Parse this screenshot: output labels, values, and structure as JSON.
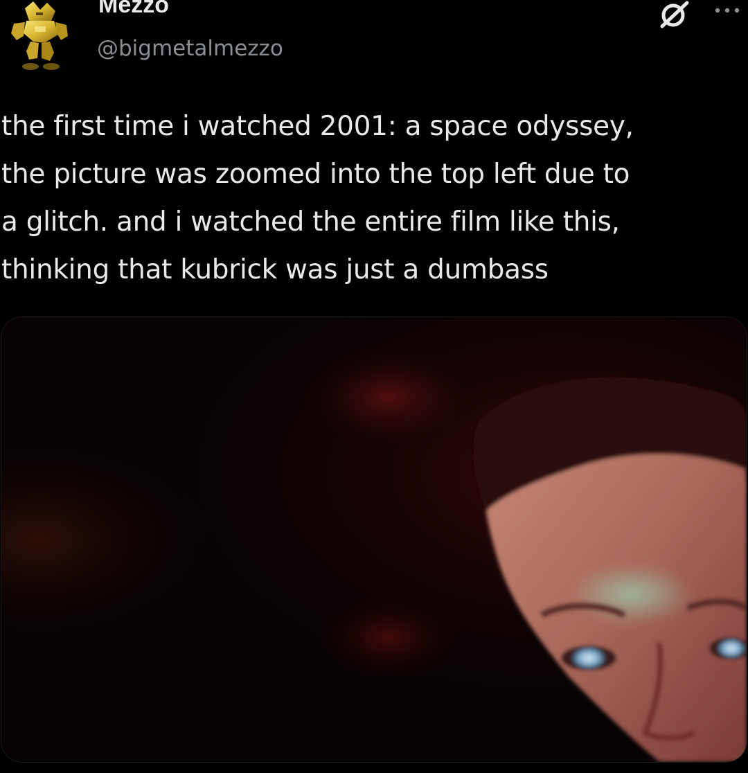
{
  "post": {
    "author": {
      "display_name": "Mezzo",
      "handle": "@bigmetalmezzo"
    },
    "text_lines": [
      "the first time i watched 2001: a space odyssey,",
      "the picture was zoomed into the top left due to",
      "a glitch. and i watched the entire film like this,",
      "thinking that kubrick was just a dumbass"
    ],
    "icons": {
      "avatar": "yellow-robot-avatar",
      "grok": "grok-icon",
      "more": "more-options-icon"
    }
  },
  "colors": {
    "background": "#000000",
    "primary_text": "#e7e9ea",
    "secondary_text": "#8b8f94"
  }
}
